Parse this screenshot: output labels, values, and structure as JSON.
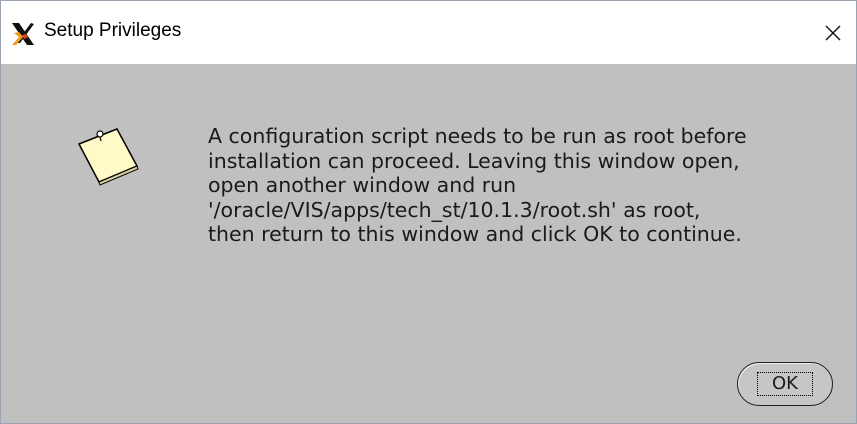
{
  "window": {
    "title": "Setup Privileges",
    "app_icon": "x-logo-icon",
    "close_icon": "close-icon",
    "titlebar_color": "#ffffff",
    "body_color": "#c0c0c0"
  },
  "dialog": {
    "icon": "note-icon",
    "message": "A configuration script needs to be run as root before\ninstallation can proceed. Leaving this window open,\nopen another window and run\n'/oracle/VIS/apps/tech_st/10.1.3/root.sh' as root,\nthen return to this window and click OK to continue.",
    "ok_label": "OK"
  }
}
